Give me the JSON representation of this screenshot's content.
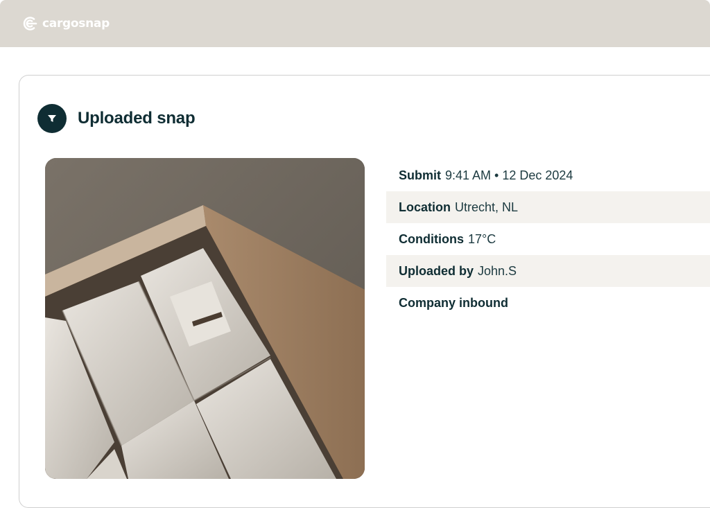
{
  "header": {
    "brand_name": "cargosnap",
    "logo_icon": "cargosnap-logo-icon",
    "background": "#dcd8d1"
  },
  "snap": {
    "title": "Uploaded snap",
    "title_icon": "filter-icon",
    "photo_alt": "Open cardboard box with sealed white poly mailer bags",
    "details": [
      {
        "label": "Submit",
        "value": "9:41 AM • 12 Dec 2024"
      },
      {
        "label": "Location",
        "value": "Utrecht, NL"
      },
      {
        "label": "Conditions",
        "value": "17°C"
      },
      {
        "label": "Uploaded by",
        "value": "John.S"
      },
      {
        "label": "Company inbound",
        "value": ""
      }
    ]
  },
  "colors": {
    "primary_dark": "#0f2d33",
    "row_shade": "#f4f2ee"
  }
}
